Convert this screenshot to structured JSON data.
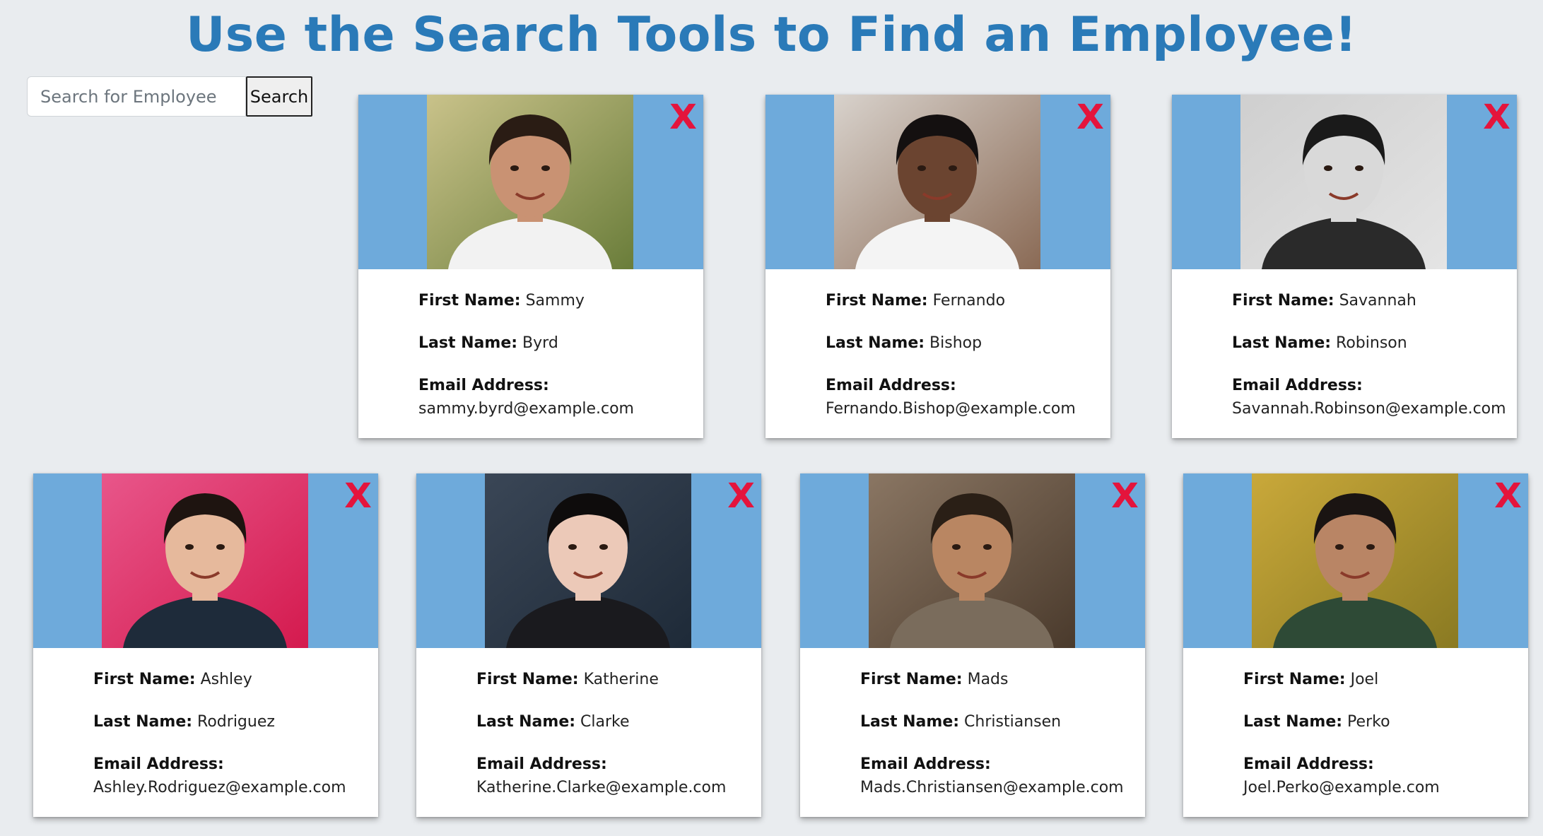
{
  "header": {
    "title": "Use the Search Tools to Find an Employee!"
  },
  "search": {
    "placeholder": "Search for Employee",
    "value": "",
    "button_label": "Search"
  },
  "labels": {
    "first_name": "First Name:",
    "last_name": "Last Name:",
    "email": "Email Address:"
  },
  "delete_label": "X",
  "colors": {
    "banner": "#6eaadb",
    "title": "#2a7ab8",
    "delete": "#e4143c",
    "background": "#e9ecef"
  },
  "employees": [
    {
      "first": "Sammy",
      "last": "Byrd",
      "email": "sammy.byrd@example.com",
      "photo": {
        "bg": "#6a7d3a",
        "bg2": "#c9c28a",
        "skin": "#c99273",
        "hair": "#2a1c14",
        "shirt": "#f2f2f2"
      }
    },
    {
      "first": "Fernando",
      "last": "Bishop",
      "email": "Fernando.Bishop@example.com",
      "photo": {
        "bg": "#8a6a55",
        "bg2": "#d8d2cc",
        "skin": "#6b4430",
        "hair": "#141010",
        "shirt": "#f4f4f4"
      }
    },
    {
      "first": "Savannah",
      "last": "Robinson",
      "email": "Savannah.Robinson@example.com",
      "photo": {
        "bg": "#e4e4e4",
        "bg2": "#cfcfcf",
        "skin": "#d9d9d9",
        "hair": "#1a1a1a",
        "shirt": "#2a2a2a"
      }
    },
    {
      "first": "Ashley",
      "last": "Rodriguez",
      "email": "Ashley.Rodriguez@example.com",
      "photo": {
        "bg": "#d41a4e",
        "bg2": "#e8568a",
        "skin": "#e6b99c",
        "hair": "#1e1410",
        "shirt": "#1e2b3a"
      }
    },
    {
      "first": "Katherine",
      "last": "Clarke",
      "email": "Katherine.Clarke@example.com",
      "photo": {
        "bg": "#1e2a38",
        "bg2": "#3a4656",
        "skin": "#ecc9b8",
        "hair": "#0e0c0c",
        "shirt": "#1a1a1e"
      }
    },
    {
      "first": "Mads",
      "last": "Christiansen",
      "email": "Mads.Christiansen@example.com",
      "photo": {
        "bg": "#4a3a2c",
        "bg2": "#8a7663",
        "skin": "#b98662",
        "hair": "#2a1f16",
        "shirt": "#7a6c5c"
      }
    },
    {
      "first": "Joel",
      "last": "Perko",
      "email": "Joel.Perko@example.com",
      "photo": {
        "bg": "#8a7a22",
        "bg2": "#c9a83a",
        "skin": "#b98565",
        "hair": "#1a1412",
        "shirt": "#2e4a36"
      }
    }
  ]
}
